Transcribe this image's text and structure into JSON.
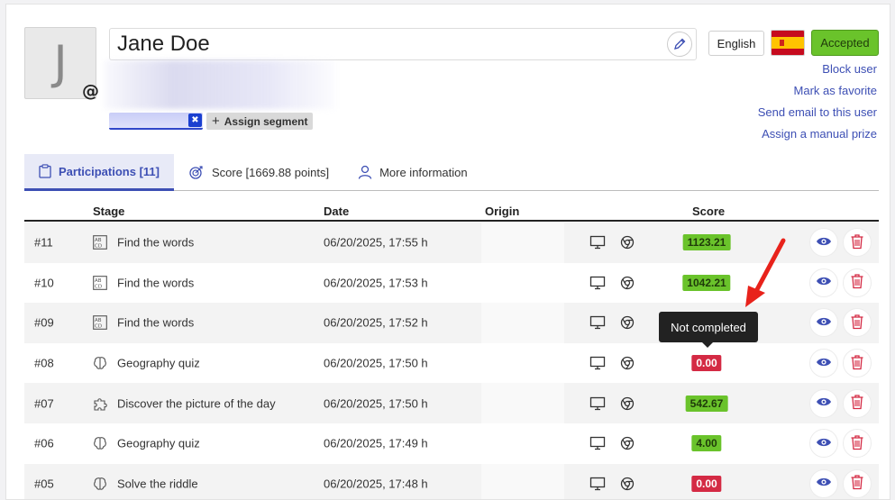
{
  "user": {
    "avatar_letter": "J",
    "at_symbol": "@",
    "name": "Jane Doe",
    "language": "English",
    "status": "Accepted"
  },
  "segment": {
    "remove_symbol": "✖",
    "assign_label": "Assign segment",
    "plus": "+"
  },
  "actions": {
    "block": "Block user",
    "favorite": "Mark as favorite",
    "email": "Send email to this user",
    "prize": "Assign a manual prize"
  },
  "tabs": [
    {
      "label": "Participations [11]",
      "icon": "clipboard-icon",
      "active": true
    },
    {
      "label": "Score [1669.88 points]",
      "icon": "target-icon",
      "active": false
    },
    {
      "label": "More information",
      "icon": "user-icon",
      "active": false
    }
  ],
  "table": {
    "headers": {
      "stage": "Stage",
      "date": "Date",
      "origin": "Origin",
      "score": "Score"
    },
    "rows": [
      {
        "num": "#11",
        "stage_icon": "word-grid-icon",
        "stage": "Find the words",
        "date": "06/20/2025, 17:55 h",
        "score": "1123.21",
        "score_type": "green"
      },
      {
        "num": "#10",
        "stage_icon": "word-grid-icon",
        "stage": "Find the words",
        "date": "06/20/2025, 17:53 h",
        "score": "1042.21",
        "score_type": "green"
      },
      {
        "num": "#09",
        "stage_icon": "word-grid-icon",
        "stage": "Find the words",
        "date": "06/20/2025, 17:52 h",
        "score": "",
        "score_type": "none"
      },
      {
        "num": "#08",
        "stage_icon": "brain-icon",
        "stage": "Geography quiz",
        "date": "06/20/2025, 17:50 h",
        "score": "0.00",
        "score_type": "red"
      },
      {
        "num": "#07",
        "stage_icon": "puzzle-icon",
        "stage": "Discover the picture of the day",
        "date": "06/20/2025, 17:50 h",
        "score": "542.67",
        "score_type": "green"
      },
      {
        "num": "#06",
        "stage_icon": "brain-icon",
        "stage": "Geography quiz",
        "date": "06/20/2025, 17:49 h",
        "score": "4.00",
        "score_type": "green"
      },
      {
        "num": "#05",
        "stage_icon": "brain-icon",
        "stage": "Solve the riddle",
        "date": "06/20/2025, 17:48 h",
        "score": "0.00",
        "score_type": "red"
      }
    ]
  },
  "tooltip": "Not completed",
  "colors": {
    "accent": "#3d4fb4",
    "success": "#6ac32b",
    "danger": "#d42a44"
  }
}
